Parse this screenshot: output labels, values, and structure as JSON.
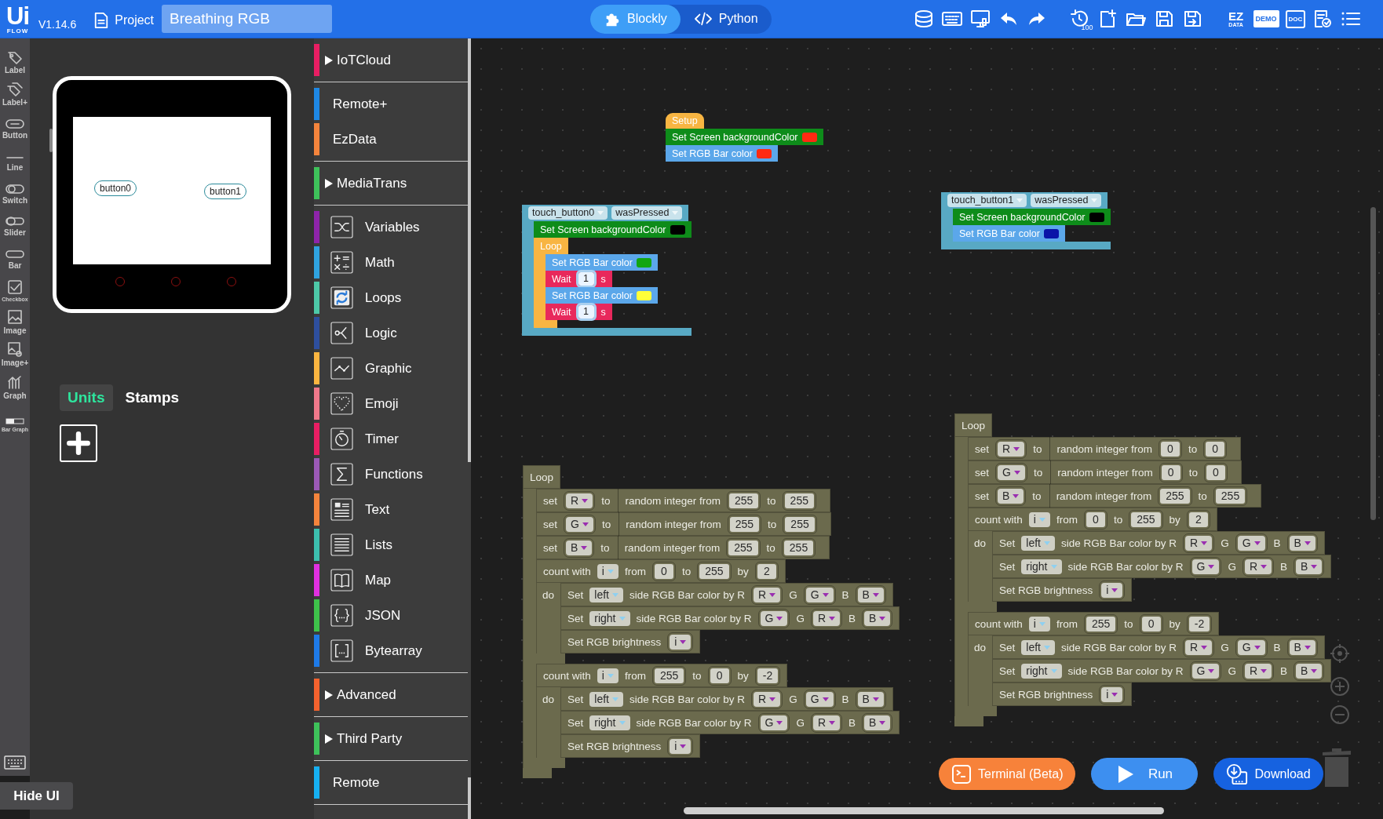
{
  "logo": {
    "title": "Ui",
    "subtitle": "FLOW"
  },
  "version": "V1.14.6",
  "project": {
    "label": "Project",
    "name": "Breathing RGB"
  },
  "mode_tabs": [
    {
      "label": "Blockly",
      "selected": true
    },
    {
      "label": "Python",
      "selected": false
    }
  ],
  "toolbar": [
    {
      "label": "100"
    },
    {
      "label": "EZ",
      "sublabel": "DATA"
    },
    {
      "label": "DEMO"
    },
    {
      "label": "DOC"
    }
  ],
  "widget_tools": [
    "Label",
    "Label+",
    "Button",
    "Line",
    "Switch",
    "Slider",
    "Bar",
    "Checkbox",
    "Image",
    "Image+",
    "Graph",
    "Bar Graph"
  ],
  "device": {
    "screen_buttons": [
      "button0",
      "button1"
    ]
  },
  "unit_tabs": [
    {
      "label": "Units",
      "selected": true
    },
    {
      "label": "Stamps",
      "selected": false
    }
  ],
  "hide_ui": "Hide UI",
  "category_sections": [
    {
      "items": [
        {
          "label": "IoTCloud",
          "kind": "expandable",
          "color": "#e91e63"
        }
      ]
    },
    {
      "items": [
        {
          "label": "Remote+",
          "kind": "plain",
          "color": "#1e88e5"
        },
        {
          "label": "EzData",
          "kind": "plain",
          "color": "#f4843c"
        }
      ]
    },
    {
      "items": [
        {
          "label": "MediaTrans",
          "kind": "expandable",
          "color": "#3ec25a"
        }
      ]
    },
    {
      "items": [
        {
          "label": "Variables",
          "kind": "icon",
          "color": "#8e24aa"
        },
        {
          "label": "Math",
          "kind": "icon",
          "color": "#2fa3e0"
        },
        {
          "label": "Loops",
          "kind": "icon",
          "color": "#4dc9a8"
        },
        {
          "label": "Logic",
          "kind": "icon",
          "color": "#2e4f9e"
        },
        {
          "label": "Graphic",
          "kind": "icon",
          "color": "#fbb540"
        },
        {
          "label": "Emoji",
          "kind": "icon",
          "color": "#f0788a"
        },
        {
          "label": "Timer",
          "kind": "icon",
          "color": "#e91e63"
        },
        {
          "label": "Functions",
          "kind": "icon",
          "color": "#9b59b6"
        },
        {
          "label": "Text",
          "kind": "icon",
          "color": "#f4843c"
        },
        {
          "label": "Lists",
          "kind": "icon",
          "color": "#3cbfae"
        },
        {
          "label": "Map",
          "kind": "icon",
          "color": "#e030e0"
        },
        {
          "label": "JSON",
          "kind": "icon",
          "color": "#3ec24a"
        },
        {
          "label": "Bytearray",
          "kind": "icon",
          "color": "#1e7ae8"
        }
      ]
    },
    {
      "items": [
        {
          "label": "Advanced",
          "kind": "expandable",
          "color": "#f4622e"
        }
      ]
    },
    {
      "items": [
        {
          "label": "Third Party",
          "kind": "expandable",
          "color": "#3ec25a"
        }
      ]
    },
    {
      "items": [
        {
          "label": "Remote",
          "kind": "plain",
          "color": "#16b0f2"
        }
      ]
    }
  ],
  "workspace": {
    "stacks": [
      [
        {
          "kind": "hat",
          "color": "#f8b542",
          "parts": [
            {
              "kind": "text",
              "text": "Setup"
            }
          ]
        },
        {
          "kind": "statement",
          "color": "#0e8c1a",
          "parts": [
            {
              "kind": "text",
              "text": "Set Screen backgroundColor"
            },
            {
              "kind": "swatch",
              "color": "#ff2a12"
            }
          ]
        },
        {
          "kind": "statement",
          "color": "#5ba7ea",
          "parts": [
            {
              "kind": "text",
              "text": "Set RGB Bar color"
            },
            {
              "kind": "swatch",
              "color": "#ff2a12"
            }
          ]
        }
      ],
      [
        {
          "kind": "event",
          "color": "#58a9c4",
          "parts": [
            {
              "kind": "dropdown",
              "text": "touch_button0"
            },
            {
              "kind": "dropdown",
              "text": "wasPressed"
            }
          ],
          "body": [
            {
              "kind": "statement",
              "color": "#0e8c1a",
              "parts": [
                {
                  "kind": "text",
                  "text": "Set Screen backgroundColor"
                },
                {
                  "kind": "swatch",
                  "color": "#000000"
                }
              ]
            },
            {
              "kind": "c-block",
              "color": "#f8b542",
              "parts": [
                {
                  "kind": "text",
                  "text": "Loop"
                }
              ],
              "body": [
                {
                  "kind": "statement",
                  "color": "#5ba7ea",
                  "parts": [
                    {
                      "kind": "text",
                      "text": "Set RGB Bar color"
                    },
                    {
                      "kind": "swatch",
                      "color": "#12a612"
                    }
                  ]
                },
                {
                  "kind": "statement",
                  "color": "#e8285c",
                  "parts": [
                    {
                      "kind": "text",
                      "text": "Wait"
                    },
                    {
                      "kind": "number",
                      "text": "1"
                    },
                    {
                      "kind": "text",
                      "text": "s"
                    }
                  ]
                },
                {
                  "kind": "statement",
                  "color": "#5ba7ea",
                  "parts": [
                    {
                      "kind": "text",
                      "text": "Set RGB Bar color"
                    },
                    {
                      "kind": "swatch",
                      "color": "#ffff3a"
                    }
                  ]
                },
                {
                  "kind": "statement",
                  "color": "#e8285c",
                  "parts": [
                    {
                      "kind": "text",
                      "text": "Wait"
                    },
                    {
                      "kind": "number",
                      "text": "1"
                    },
                    {
                      "kind": "text",
                      "text": "s"
                    }
                  ]
                }
              ]
            }
          ]
        }
      ],
      [
        {
          "kind": "event",
          "color": "#58a9c4",
          "parts": [
            {
              "kind": "dropdown",
              "text": "touch_button1"
            },
            {
              "kind": "dropdown",
              "text": "wasPressed"
            }
          ],
          "body": [
            {
              "kind": "statement",
              "color": "#0e8c1a",
              "parts": [
                {
                  "kind": "text",
                  "text": "Set Screen backgroundColor"
                },
                {
                  "kind": "swatch",
                  "color": "#000000"
                }
              ]
            },
            {
              "kind": "statement",
              "color": "#5ba7ea",
              "parts": [
                {
                  "kind": "text",
                  "text": "Set RGB Bar color"
                },
                {
                  "kind": "swatch",
                  "color": "#0a14a8"
                }
              ]
            }
          ]
        }
      ],
      [
        {
          "kind": "c-block",
          "color": "#6b6a4d",
          "parts": [
            {
              "kind": "text",
              "text": "Loop"
            }
          ],
          "body": [
            {
              "kind": "statement",
              "color": "#6b6a4d",
              "parts": [
                {
                  "kind": "text",
                  "text": "set"
                },
                {
                  "kind": "variable",
                  "text": "R"
                },
                {
                  "kind": "text",
                  "text": "to"
                },
                {
                  "kind": "value",
                  "parts": [
                    {
                      "kind": "text",
                      "text": "random integer from"
                    },
                    {
                      "kind": "number",
                      "text": "255"
                    },
                    {
                      "kind": "text",
                      "text": "to"
                    },
                    {
                      "kind": "number",
                      "text": "255"
                    }
                  ]
                }
              ]
            },
            {
              "kind": "statement",
              "color": "#6b6a4d",
              "parts": [
                {
                  "kind": "text",
                  "text": "set"
                },
                {
                  "kind": "variable",
                  "text": "G"
                },
                {
                  "kind": "text",
                  "text": "to"
                },
                {
                  "kind": "value",
                  "parts": [
                    {
                      "kind": "text",
                      "text": "random integer from"
                    },
                    {
                      "kind": "number",
                      "text": "255"
                    },
                    {
                      "kind": "text",
                      "text": "to"
                    },
                    {
                      "kind": "number",
                      "text": "255"
                    }
                  ]
                }
              ]
            },
            {
              "kind": "statement",
              "color": "#6b6a4d",
              "parts": [
                {
                  "kind": "text",
                  "text": "set"
                },
                {
                  "kind": "variable",
                  "text": "B"
                },
                {
                  "kind": "text",
                  "text": "to"
                },
                {
                  "kind": "value",
                  "parts": [
                    {
                      "kind": "text",
                      "text": "random integer from"
                    },
                    {
                      "kind": "number",
                      "text": "255"
                    },
                    {
                      "kind": "text",
                      "text": "to"
                    },
                    {
                      "kind": "number",
                      "text": "255"
                    }
                  ]
                }
              ]
            },
            {
              "kind": "c-block",
              "color": "#6b6a4d",
              "body_label": "do",
              "parts": [
                {
                  "kind": "text",
                  "text": "count with"
                },
                {
                  "kind": "menu",
                  "text": "i"
                },
                {
                  "kind": "text",
                  "text": "from"
                },
                {
                  "kind": "number",
                  "text": "0"
                },
                {
                  "kind": "text",
                  "text": "to"
                },
                {
                  "kind": "number",
                  "text": "255"
                },
                {
                  "kind": "text",
                  "text": "by"
                },
                {
                  "kind": "number",
                  "text": "2"
                }
              ],
              "body": [
                {
                  "kind": "statement",
                  "color": "#6b6a4d",
                  "parts": [
                    {
                      "kind": "text",
                      "text": "Set"
                    },
                    {
                      "kind": "menu",
                      "text": "left"
                    },
                    {
                      "kind": "text",
                      "text": "side RGB Bar color by R"
                    },
                    {
                      "kind": "variable",
                      "text": "R"
                    },
                    {
                      "kind": "text",
                      "text": "G"
                    },
                    {
                      "kind": "variable",
                      "text": "G"
                    },
                    {
                      "kind": "text",
                      "text": "B"
                    },
                    {
                      "kind": "variable",
                      "text": "B"
                    }
                  ]
                },
                {
                  "kind": "statement",
                  "color": "#6b6a4d",
                  "parts": [
                    {
                      "kind": "text",
                      "text": "Set"
                    },
                    {
                      "kind": "menu",
                      "text": "right"
                    },
                    {
                      "kind": "text",
                      "text": "side RGB Bar color by R"
                    },
                    {
                      "kind": "variable",
                      "text": "G"
                    },
                    {
                      "kind": "text",
                      "text": "G"
                    },
                    {
                      "kind": "variable",
                      "text": "R"
                    },
                    {
                      "kind": "text",
                      "text": "B"
                    },
                    {
                      "kind": "variable",
                      "text": "B"
                    }
                  ]
                },
                {
                  "kind": "statement",
                  "color": "#6b6a4d",
                  "parts": [
                    {
                      "kind": "text",
                      "text": "Set RGB brightness"
                    },
                    {
                      "kind": "variable",
                      "text": "i"
                    }
                  ]
                }
              ]
            },
            {
              "kind": "c-block",
              "color": "#6b6a4d",
              "body_label": "do",
              "parts": [
                {
                  "kind": "text",
                  "text": "count with"
                },
                {
                  "kind": "menu",
                  "text": "i"
                },
                {
                  "kind": "text",
                  "text": "from"
                },
                {
                  "kind": "number",
                  "text": "255"
                },
                {
                  "kind": "text",
                  "text": "to"
                },
                {
                  "kind": "number",
                  "text": "0"
                },
                {
                  "kind": "text",
                  "text": "by"
                },
                {
                  "kind": "number",
                  "text": "-2"
                }
              ],
              "body": [
                {
                  "kind": "statement",
                  "color": "#6b6a4d",
                  "parts": [
                    {
                      "kind": "text",
                      "text": "Set"
                    },
                    {
                      "kind": "menu",
                      "text": "left"
                    },
                    {
                      "kind": "text",
                      "text": "side RGB Bar color by R"
                    },
                    {
                      "kind": "variable",
                      "text": "R"
                    },
                    {
                      "kind": "text",
                      "text": "G"
                    },
                    {
                      "kind": "variable",
                      "text": "G"
                    },
                    {
                      "kind": "text",
                      "text": "B"
                    },
                    {
                      "kind": "variable",
                      "text": "B"
                    }
                  ]
                },
                {
                  "kind": "statement",
                  "color": "#6b6a4d",
                  "parts": [
                    {
                      "kind": "text",
                      "text": "Set"
                    },
                    {
                      "kind": "menu",
                      "text": "right"
                    },
                    {
                      "kind": "text",
                      "text": "side RGB Bar color by R"
                    },
                    {
                      "kind": "variable",
                      "text": "G"
                    },
                    {
                      "kind": "text",
                      "text": "G"
                    },
                    {
                      "kind": "variable",
                      "text": "R"
                    },
                    {
                      "kind": "text",
                      "text": "B"
                    },
                    {
                      "kind": "variable",
                      "text": "B"
                    }
                  ]
                },
                {
                  "kind": "statement",
                  "color": "#6b6a4d",
                  "parts": [
                    {
                      "kind": "text",
                      "text": "Set RGB brightness"
                    },
                    {
                      "kind": "variable",
                      "text": "i"
                    }
                  ]
                }
              ]
            }
          ]
        }
      ],
      [
        {
          "kind": "c-block",
          "color": "#6b6a4d",
          "parts": [
            {
              "kind": "text",
              "text": "Loop"
            }
          ],
          "body": [
            {
              "kind": "statement",
              "color": "#6b6a4d",
              "parts": [
                {
                  "kind": "text",
                  "text": "set"
                },
                {
                  "kind": "variable",
                  "text": "R"
                },
                {
                  "kind": "text",
                  "text": "to"
                },
                {
                  "kind": "value",
                  "parts": [
                    {
                      "kind": "text",
                      "text": "random integer from"
                    },
                    {
                      "kind": "number",
                      "text": "0"
                    },
                    {
                      "kind": "text",
                      "text": "to"
                    },
                    {
                      "kind": "number",
                      "text": "0"
                    }
                  ]
                }
              ]
            },
            {
              "kind": "statement",
              "color": "#6b6a4d",
              "parts": [
                {
                  "kind": "text",
                  "text": "set"
                },
                {
                  "kind": "variable",
                  "text": "G"
                },
                {
                  "kind": "text",
                  "text": "to"
                },
                {
                  "kind": "value",
                  "parts": [
                    {
                      "kind": "text",
                      "text": "random integer from"
                    },
                    {
                      "kind": "number",
                      "text": "0"
                    },
                    {
                      "kind": "text",
                      "text": "to"
                    },
                    {
                      "kind": "number",
                      "text": "0"
                    }
                  ]
                }
              ]
            },
            {
              "kind": "statement",
              "color": "#6b6a4d",
              "parts": [
                {
                  "kind": "text",
                  "text": "set"
                },
                {
                  "kind": "variable",
                  "text": "B"
                },
                {
                  "kind": "text",
                  "text": "to"
                },
                {
                  "kind": "value",
                  "parts": [
                    {
                      "kind": "text",
                      "text": "random integer from"
                    },
                    {
                      "kind": "number",
                      "text": "255"
                    },
                    {
                      "kind": "text",
                      "text": "to"
                    },
                    {
                      "kind": "number",
                      "text": "255"
                    }
                  ]
                }
              ]
            },
            {
              "kind": "c-block",
              "color": "#6b6a4d",
              "body_label": "do",
              "parts": [
                {
                  "kind": "text",
                  "text": "count with"
                },
                {
                  "kind": "menu",
                  "text": "i"
                },
                {
                  "kind": "text",
                  "text": "from"
                },
                {
                  "kind": "number",
                  "text": "0"
                },
                {
                  "kind": "text",
                  "text": "to"
                },
                {
                  "kind": "number",
                  "text": "255"
                },
                {
                  "kind": "text",
                  "text": "by"
                },
                {
                  "kind": "number",
                  "text": "2"
                }
              ],
              "body": [
                {
                  "kind": "statement",
                  "color": "#6b6a4d",
                  "parts": [
                    {
                      "kind": "text",
                      "text": "Set"
                    },
                    {
                      "kind": "menu",
                      "text": "left"
                    },
                    {
                      "kind": "text",
                      "text": "side RGB Bar color by R"
                    },
                    {
                      "kind": "variable",
                      "text": "R"
                    },
                    {
                      "kind": "text",
                      "text": "G"
                    },
                    {
                      "kind": "variable",
                      "text": "G"
                    },
                    {
                      "kind": "text",
                      "text": "B"
                    },
                    {
                      "kind": "variable",
                      "text": "B"
                    }
                  ]
                },
                {
                  "kind": "statement",
                  "color": "#6b6a4d",
                  "parts": [
                    {
                      "kind": "text",
                      "text": "Set"
                    },
                    {
                      "kind": "menu",
                      "text": "right"
                    },
                    {
                      "kind": "text",
                      "text": "side RGB Bar color by R"
                    },
                    {
                      "kind": "variable",
                      "text": "G"
                    },
                    {
                      "kind": "text",
                      "text": "G"
                    },
                    {
                      "kind": "variable",
                      "text": "R"
                    },
                    {
                      "kind": "text",
                      "text": "B"
                    },
                    {
                      "kind": "variable",
                      "text": "B"
                    }
                  ]
                },
                {
                  "kind": "statement",
                  "color": "#6b6a4d",
                  "parts": [
                    {
                      "kind": "text",
                      "text": "Set RGB brightness"
                    },
                    {
                      "kind": "variable",
                      "text": "i"
                    }
                  ]
                }
              ]
            },
            {
              "kind": "c-block",
              "color": "#6b6a4d",
              "body_label": "do",
              "parts": [
                {
                  "kind": "text",
                  "text": "count with"
                },
                {
                  "kind": "menu",
                  "text": "i"
                },
                {
                  "kind": "text",
                  "text": "from"
                },
                {
                  "kind": "number",
                  "text": "255"
                },
                {
                  "kind": "text",
                  "text": "to"
                },
                {
                  "kind": "number",
                  "text": "0"
                },
                {
                  "kind": "text",
                  "text": "by"
                },
                {
                  "kind": "number",
                  "text": "-2"
                }
              ],
              "body": [
                {
                  "kind": "statement",
                  "color": "#6b6a4d",
                  "parts": [
                    {
                      "kind": "text",
                      "text": "Set"
                    },
                    {
                      "kind": "menu",
                      "text": "left"
                    },
                    {
                      "kind": "text",
                      "text": "side RGB Bar color by R"
                    },
                    {
                      "kind": "variable",
                      "text": "R"
                    },
                    {
                      "kind": "text",
                      "text": "G"
                    },
                    {
                      "kind": "variable",
                      "text": "G"
                    },
                    {
                      "kind": "text",
                      "text": "B"
                    },
                    {
                      "kind": "variable",
                      "text": "B"
                    }
                  ]
                },
                {
                  "kind": "statement",
                  "color": "#6b6a4d",
                  "parts": [
                    {
                      "kind": "text",
                      "text": "Set"
                    },
                    {
                      "kind": "menu",
                      "text": "right"
                    },
                    {
                      "kind": "text",
                      "text": "side RGB Bar color by R"
                    },
                    {
                      "kind": "variable",
                      "text": "G"
                    },
                    {
                      "kind": "text",
                      "text": "G"
                    },
                    {
                      "kind": "variable",
                      "text": "R"
                    },
                    {
                      "kind": "text",
                      "text": "B"
                    },
                    {
                      "kind": "variable",
                      "text": "B"
                    }
                  ]
                },
                {
                  "kind": "statement",
                  "color": "#6b6a4d",
                  "parts": [
                    {
                      "kind": "text",
                      "text": "Set RGB brightness"
                    },
                    {
                      "kind": "variable",
                      "text": "i"
                    }
                  ]
                }
              ]
            }
          ]
        }
      ]
    ]
  },
  "action_buttons": [
    {
      "label": "Terminal (Beta)",
      "kind": "terminal"
    },
    {
      "label": "Run",
      "kind": "run"
    },
    {
      "label": "Download",
      "kind": "download"
    }
  ]
}
